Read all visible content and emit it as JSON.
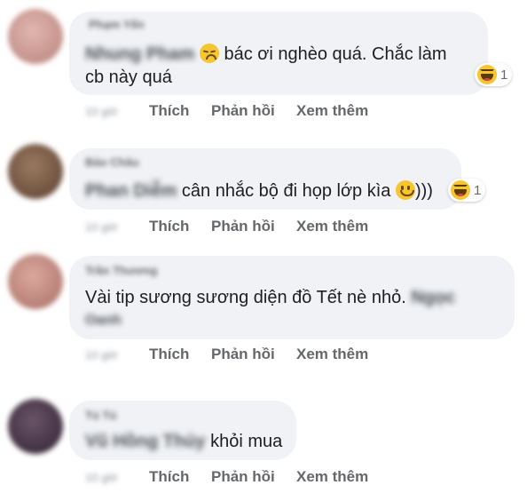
{
  "comments": [
    {
      "author": "Phạm Yến",
      "tag": "Nhung Pham",
      "text_line1": "bác ơi nghèo quá. Chắc làm",
      "text_line2": "cb này quá",
      "reaction_count": "1",
      "time": "10 giờ",
      "like": "Thích",
      "reply": "Phản hồi",
      "more": "Xem thêm"
    },
    {
      "author": "Bảo Châu",
      "tag": "Phan Diễm",
      "text_line1": "cân nhắc bộ đi họp lớp kìa",
      "text_suffix": ")))",
      "reaction_count": "1",
      "time": "10 giờ",
      "like": "Thích",
      "reply": "Phản hồi",
      "more": "Xem thêm"
    },
    {
      "author": "Trần Thương",
      "text_line1": "Vài tip sương sương diện đồ Tết nè nhỏ.",
      "tag": "Ngọc",
      "tag2": "Oanh",
      "time": "10 giờ",
      "like": "Thích",
      "reply": "Phản hồi",
      "more": "Xem thêm"
    },
    {
      "author": "Tú Tú",
      "tag": "Vũ Hồng Thủy",
      "text_line1": "khỏi mua",
      "time": "10 giờ",
      "like": "Thích",
      "reply": "Phản hồi",
      "more": "Xem thêm"
    }
  ],
  "colors": {
    "bubble": "#f0f2f5",
    "action_text": "#65676b",
    "avatar_1": "#c99a94",
    "avatar_2": "#6e4e3a",
    "avatar_3": "#c48a80",
    "avatar_4": "#3e3140"
  },
  "icons": [
    "sad-emoji-icon",
    "smile-emoji-icon",
    "haha-reaction-icon"
  ]
}
